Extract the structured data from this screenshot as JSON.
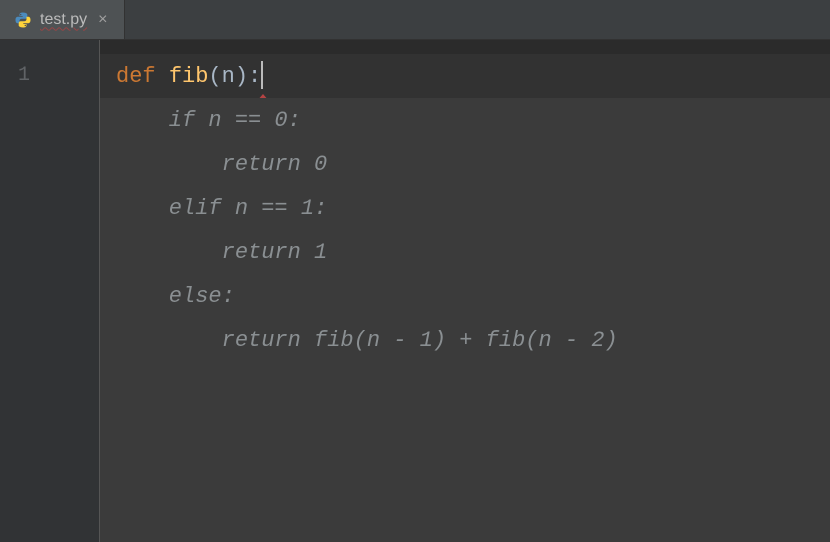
{
  "tab": {
    "filename": "test.py",
    "close": "×"
  },
  "gutter": {
    "line_numbers": [
      "1"
    ]
  },
  "code": {
    "line1": {
      "kw": "def",
      "sp1": " ",
      "fn": "fib",
      "lparen": "(",
      "param": "n",
      "rparen": ")",
      "colon": ":"
    }
  },
  "suggestion": {
    "s1": "    if n == 0:",
    "s2": "        return 0",
    "s3": "    elif n == 1:",
    "s4": "        return 1",
    "s5": "    else:",
    "s6": "        return fib(n - 1) + fib(n - 2)"
  }
}
